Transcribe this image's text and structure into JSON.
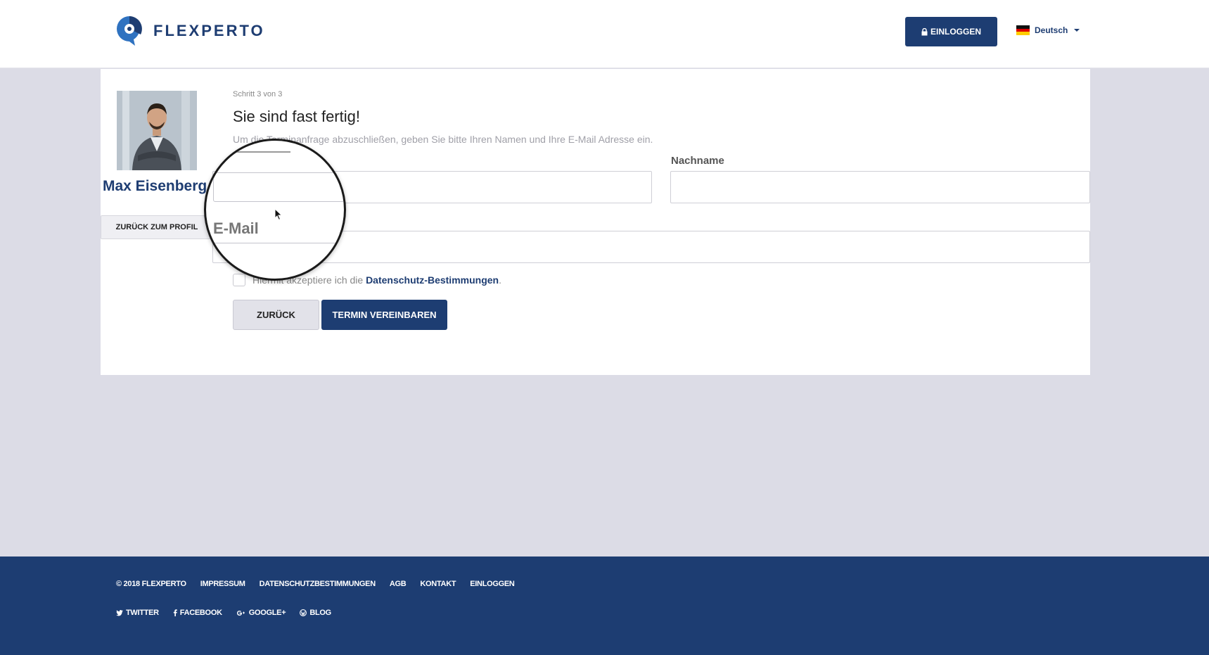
{
  "header": {
    "logo_text": "FLEXPERTO",
    "login_label": "EINLOGGEN",
    "language": "Deutsch"
  },
  "profile": {
    "name": "Max Eisenberg",
    "back_label": "ZURÜCK ZUM PROFIL"
  },
  "form": {
    "step": "Schritt 3 von 3",
    "headline": "Sie sind fast fertig!",
    "intro": "Um die Terminanfrage abzuschließen, geben Sie bitte Ihren Namen und Ihre E-Mail Adresse ein.",
    "lastname_label": "Nachname",
    "email_label": "E-Mail",
    "consent_prefix": "Hiermit akzeptiere ich die",
    "consent_link": "Datenschutz-Bestimmungen",
    "consent_suffix": ".",
    "back_button": "ZURÜCK",
    "submit_button": "TERMIN VEREINBAREN"
  },
  "footer": {
    "copyright": "© 2018 FLEXPERTO",
    "links": [
      "IMPRESSUM",
      "DATENSCHUTZBESTIMMUNGEN",
      "AGB",
      "KONTAKT",
      "EINLOGGEN"
    ],
    "social": [
      {
        "label": "TWITTER",
        "icon": "twitter-icon"
      },
      {
        "label": "FACEBOOK",
        "icon": "facebook-icon"
      },
      {
        "label": "GOOGLE+",
        "icon": "google-plus-icon"
      },
      {
        "label": "BLOG",
        "icon": "wordpress-icon"
      }
    ]
  },
  "colors": {
    "brand": "#1d3d72",
    "background": "#dcdce6"
  }
}
